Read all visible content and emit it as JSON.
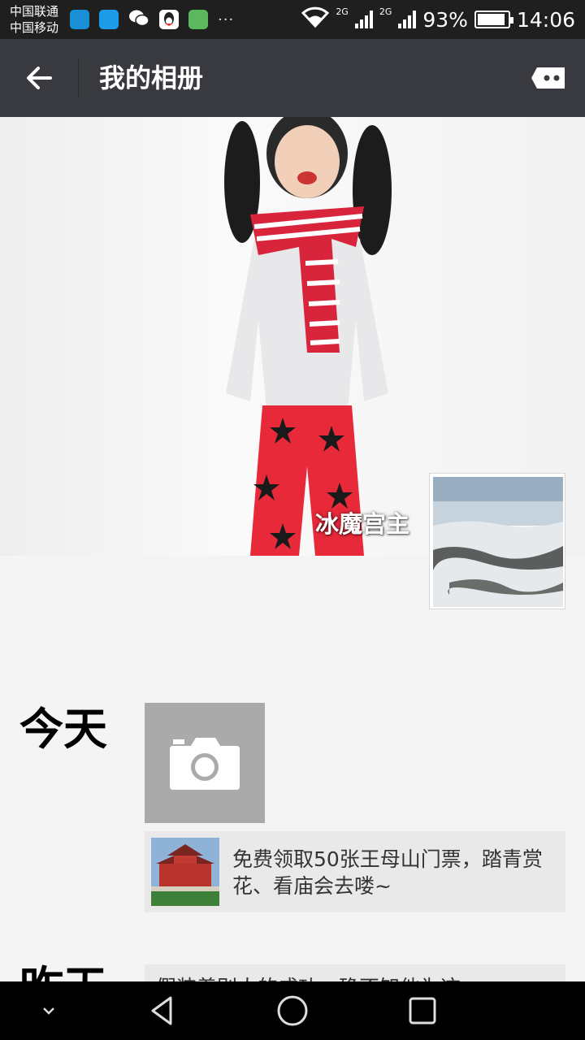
{
  "status_bar": {
    "carrier_1": "中国联通",
    "carrier_2": "中国移动",
    "more": "···",
    "net_1": "2G",
    "net_2": "2G",
    "battery_percent": "93%",
    "battery_level": 0.93,
    "time": "14:06"
  },
  "header": {
    "title": "我的相册"
  },
  "profile": {
    "nickname": "冰魔宫主"
  },
  "timeline": [
    {
      "day": "今天",
      "post_text": "免费领取50张王母山门票，踏青赏花、看庙会去喽~"
    },
    {
      "day": "昨天",
      "post_text": "假装着别人的成功，确不知他为这"
    }
  ],
  "colors": {
    "status_bar": "#1f1f1f",
    "title_bar": "#393a3f",
    "camera_tile": "#aaaaaa",
    "post_bg": "#e9e9e9",
    "nav_bar": "#000000"
  }
}
